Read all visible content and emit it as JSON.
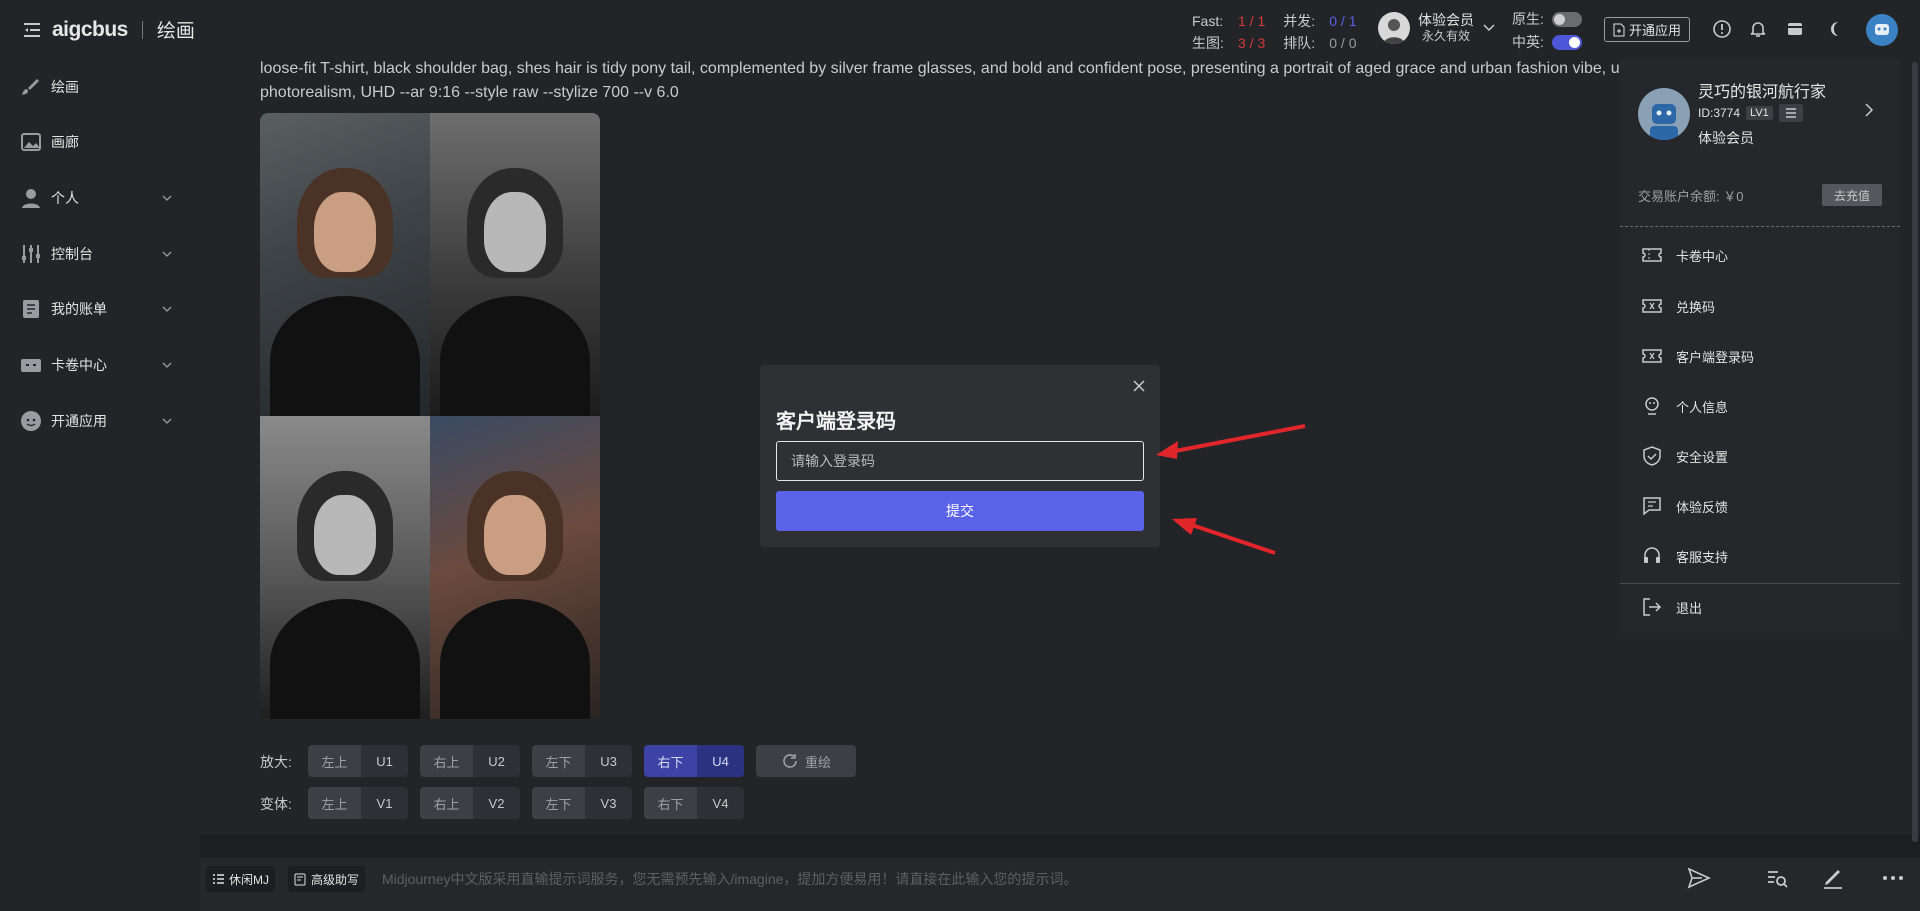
{
  "header": {
    "logo": "aigcbus",
    "page_title": "绘画",
    "stats": {
      "fast_label": "Fast:",
      "fast_value": "1 / 1",
      "concurrent_label": "并发:",
      "concurrent_value": "0 / 1",
      "gen_label": "生图:",
      "gen_value": "3 / 3",
      "queue_label": "排队:",
      "queue_value": "0 / 0"
    },
    "account": {
      "name": "体验会员",
      "validity": "永久有效"
    },
    "toggles": {
      "native_label": "原生:",
      "native_on": false,
      "cn_en_label": "中英:",
      "cn_en_on": true
    },
    "open_app_label": "开通应用"
  },
  "sidebar": {
    "items": [
      {
        "label": "绘画",
        "icon": "brush-icon"
      },
      {
        "label": "画廊",
        "icon": "gallery-icon"
      },
      {
        "label": "个人",
        "icon": "person-icon"
      },
      {
        "label": "控制台",
        "icon": "sliders-icon"
      },
      {
        "label": "我的账单",
        "icon": "bill-icon"
      },
      {
        "label": "卡卷中心",
        "icon": "card-icon"
      },
      {
        "label": "开通应用",
        "icon": "app-icon"
      }
    ]
  },
  "main": {
    "prompt_line1": "loose-fit T-shirt, black shoulder bag, shes hair is tidy pony tail, complemented by silver frame glasses, and bold and confident pose, presenting a portrait of aged grace and urban fashion vibe, u",
    "prompt_line2": "photorealism, UHD --ar 9:16 --style raw --stylize 700 --v 6.0",
    "upscale_label": "放大:",
    "variation_label": "变体:",
    "upscale_buttons": [
      {
        "pos": "左上",
        "code": "U1"
      },
      {
        "pos": "右上",
        "code": "U2"
      },
      {
        "pos": "左下",
        "code": "U3"
      },
      {
        "pos": "右下",
        "code": "U4"
      }
    ],
    "variation_buttons": [
      {
        "pos": "左上",
        "code": "V1"
      },
      {
        "pos": "右上",
        "code": "V2"
      },
      {
        "pos": "左下",
        "code": "V3"
      },
      {
        "pos": "右下",
        "code": "V4"
      }
    ],
    "redraw_label": "重绘"
  },
  "bottom": {
    "chip_relax": "休闲MJ",
    "chip_assist": "高级助写",
    "placeholder": "Midjourney中文版采用直输提示词服务，您无需预先输入/imagine，提加方便易用！请直接在此输入您的提示词。"
  },
  "modal": {
    "title": "客户端登录码",
    "input_placeholder": "请输入登录码",
    "submit_label": "提交"
  },
  "user_panel": {
    "name": "灵巧的银河航行家",
    "id": "ID:3774",
    "level": "LV1",
    "member": "体验会员",
    "balance": "交易账户余额: ￥0",
    "recharge": "去充值",
    "items": [
      {
        "label": "卡卷中心",
        "icon": "ticket-icon"
      },
      {
        "label": "兑换码",
        "icon": "redeem-icon"
      },
      {
        "label": "客户端登录码",
        "icon": "login-code-icon"
      },
      {
        "label": "个人信息",
        "icon": "profile-icon"
      },
      {
        "label": "安全设置",
        "icon": "shield-icon"
      },
      {
        "label": "体验反馈",
        "icon": "feedback-icon"
      },
      {
        "label": "客服支持",
        "icon": "headset-icon"
      }
    ],
    "logout": "退出"
  }
}
